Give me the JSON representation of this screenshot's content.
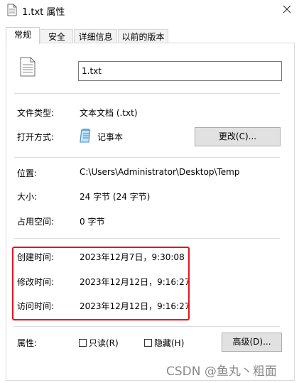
{
  "window": {
    "title": "1.txt 属性"
  },
  "tabs": [
    {
      "label": "常规"
    },
    {
      "label": "安全"
    },
    {
      "label": "详细信息"
    },
    {
      "label": "以前的版本"
    }
  ],
  "general": {
    "filename": "1.txt",
    "file_type_label": "文件类型:",
    "file_type_value": "文本文档 (.txt)",
    "open_with_label": "打开方式:",
    "open_with_value": "记事本",
    "change_button": "更改(C)...",
    "location_label": "位置:",
    "location_value": "C:\\Users\\Administrator\\Desktop\\Temp",
    "size_label": "大小:",
    "size_value": "24 字节 (24 字节)",
    "disk_size_label": "占用空间:",
    "disk_size_value": "0 字节",
    "created_label": "创建时间:",
    "created_value": "2023年12月7日，9:30:08",
    "modified_label": "修改时间:",
    "modified_value": "2023年12月12日，9:16:27",
    "accessed_label": "访问时间:",
    "accessed_value": "2023年12月12日，9:16:27",
    "attributes_label": "属性:",
    "readonly_label": "只读(R)",
    "hidden_label": "隐藏(H)",
    "advanced_button": "高级(D)..."
  },
  "watermark": "CSDN @鱼丸丶粗面",
  "colors": {
    "highlight": "#e8141d"
  }
}
